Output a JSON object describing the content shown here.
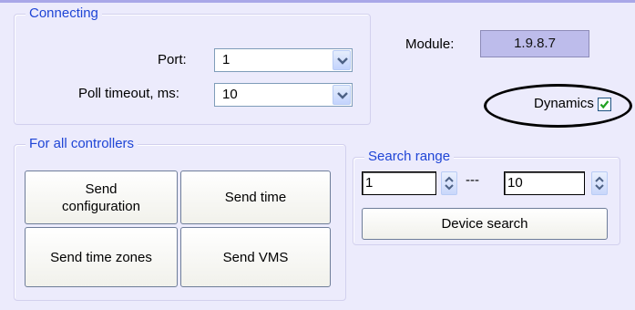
{
  "connecting": {
    "title": "Connecting",
    "port_label": "Port:",
    "port_value": "1",
    "poll_label": "Poll timeout, ms:",
    "poll_value": "10",
    "module_label": "Module:",
    "module_value": "1.9.8.7",
    "dynamics_label": "Dynamics",
    "dynamics_checked": true
  },
  "controllers": {
    "title": "For all controllers",
    "send_configuration": "Send configuration",
    "send_time": "Send time",
    "send_time_zones": "Send time zones",
    "send_vms": "Send VMS"
  },
  "search_range": {
    "title": "Search range",
    "from_value": "1",
    "separator": "---",
    "to_value": "10",
    "device_search": "Device search"
  },
  "colors": {
    "background": "#ECEBFC",
    "group_title": "#1F45D6",
    "module_field": "#BDBCEB",
    "checkmark": "#21A121"
  }
}
